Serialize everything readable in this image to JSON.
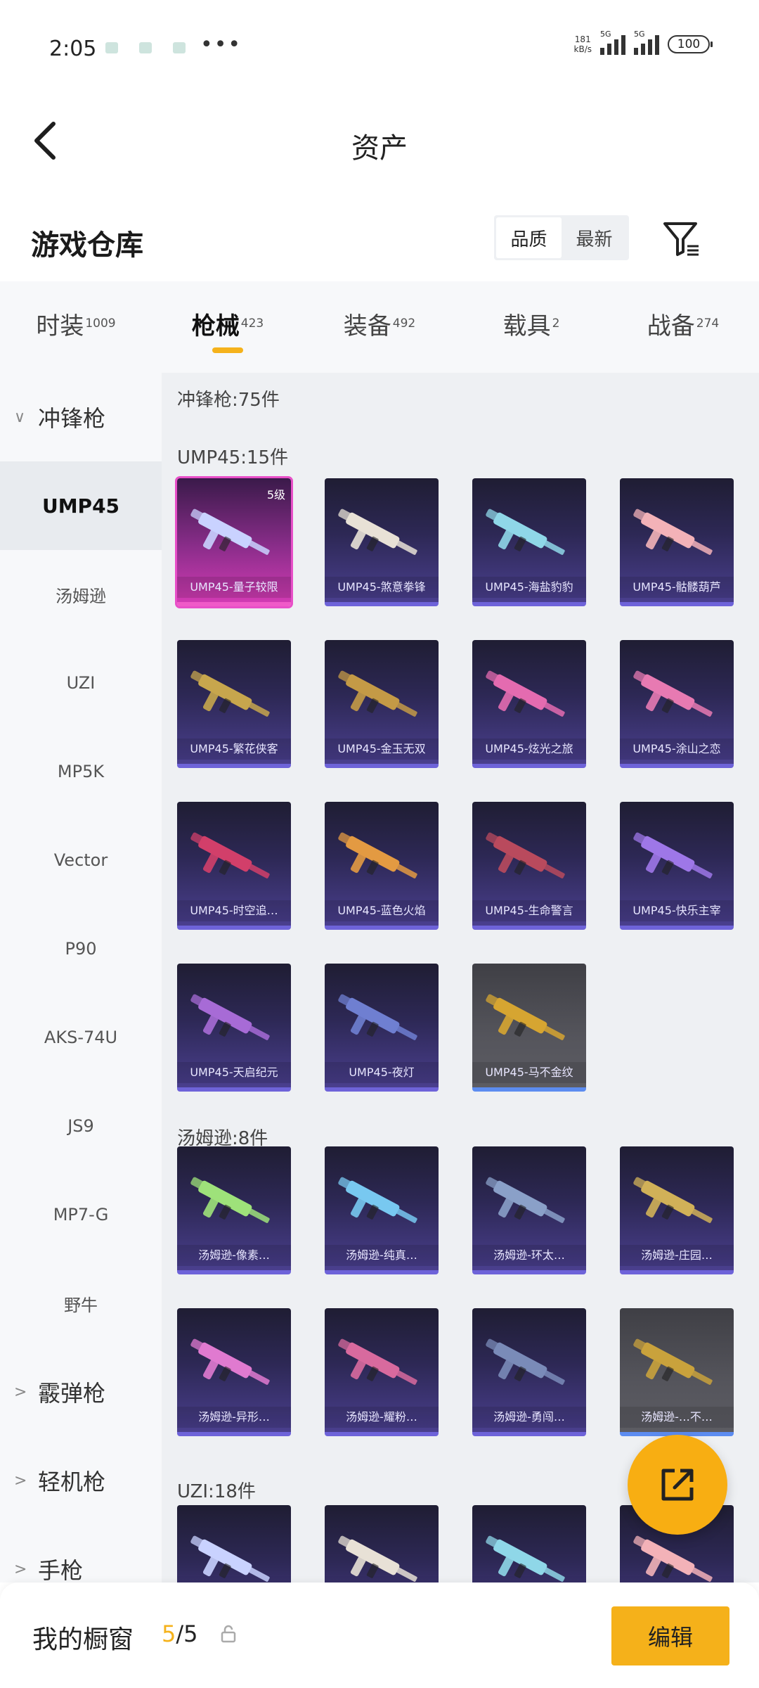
{
  "status_bar": {
    "time": "2:05",
    "net_speed_value": "181",
    "net_speed_unit": "kB/s",
    "signal_labels": [
      "5G",
      "5G"
    ],
    "battery": "100"
  },
  "header": {
    "title": "资产"
  },
  "warehouse": {
    "title": "游戏仓库",
    "sort_options": [
      "品质",
      "最新"
    ],
    "active_sort": "最新"
  },
  "tabs": [
    {
      "label": "时装",
      "count": "1009"
    },
    {
      "label": "枪械",
      "count": "423",
      "active": true
    },
    {
      "label": "装备",
      "count": "492"
    },
    {
      "label": "载具",
      "count": "2"
    },
    {
      "label": "战备",
      "count": "274"
    }
  ],
  "sidebar": {
    "groups": [
      {
        "label": "冲锋枪",
        "expanded": true
      },
      {
        "label": "霰弹枪"
      },
      {
        "label": "轻机枪"
      },
      {
        "label": "手枪"
      }
    ],
    "items": [
      "UMP45",
      "汤姆逊",
      "UZI",
      "MP5K",
      "Vector",
      "P90",
      "AKS-74U",
      "JS9",
      "MP7-G",
      "野牛"
    ],
    "active_item": "UMP45"
  },
  "content": {
    "category_title": "冲锋枪:75件",
    "sections": [
      {
        "title": "UMP45:15件",
        "items": [
          {
            "name": "UMP45-量子较限",
            "level": "5级"
          },
          {
            "name": "UMP45-煞意拳锋"
          },
          {
            "name": "UMP45-海盐豹豹"
          },
          {
            "name": "UMP45-骷髅葫芦"
          },
          {
            "name": "UMP45-繁花侠客"
          },
          {
            "name": "UMP45-金玉无双"
          },
          {
            "name": "UMP45-炫光之旅"
          },
          {
            "name": "UMP45-涂山之恋"
          },
          {
            "name": "UMP45-时空追…"
          },
          {
            "name": "UMP45-蓝色火焰"
          },
          {
            "name": "UMP45-生命警言"
          },
          {
            "name": "UMP45-快乐主宰"
          },
          {
            "name": "UMP45-天启纪元"
          },
          {
            "name": "UMP45-夜灯"
          },
          {
            "name": "UMP45-马不金纹"
          }
        ]
      },
      {
        "title": "汤姆逊:8件",
        "items": [
          {
            "name": "汤姆逊-像素…"
          },
          {
            "name": "汤姆逊-纯真…"
          },
          {
            "name": "汤姆逊-环太…"
          },
          {
            "name": "汤姆逊-庄园…"
          },
          {
            "name": "汤姆逊-异形…"
          },
          {
            "name": "汤姆逊-耀粉…"
          },
          {
            "name": "汤姆逊-勇闯…"
          },
          {
            "name": "汤姆逊-…不…"
          }
        ]
      },
      {
        "title": "UZI:18件",
        "items": []
      }
    ]
  },
  "bottom_bar": {
    "label": "我的橱窗",
    "count_current": "5",
    "count_total": "/5",
    "edit_label": "编辑"
  },
  "colors": {
    "accent": "#f5b21b",
    "card_purple": "#2d2855",
    "card_legend": "#d13bb3",
    "card_grey": "#55555c"
  }
}
